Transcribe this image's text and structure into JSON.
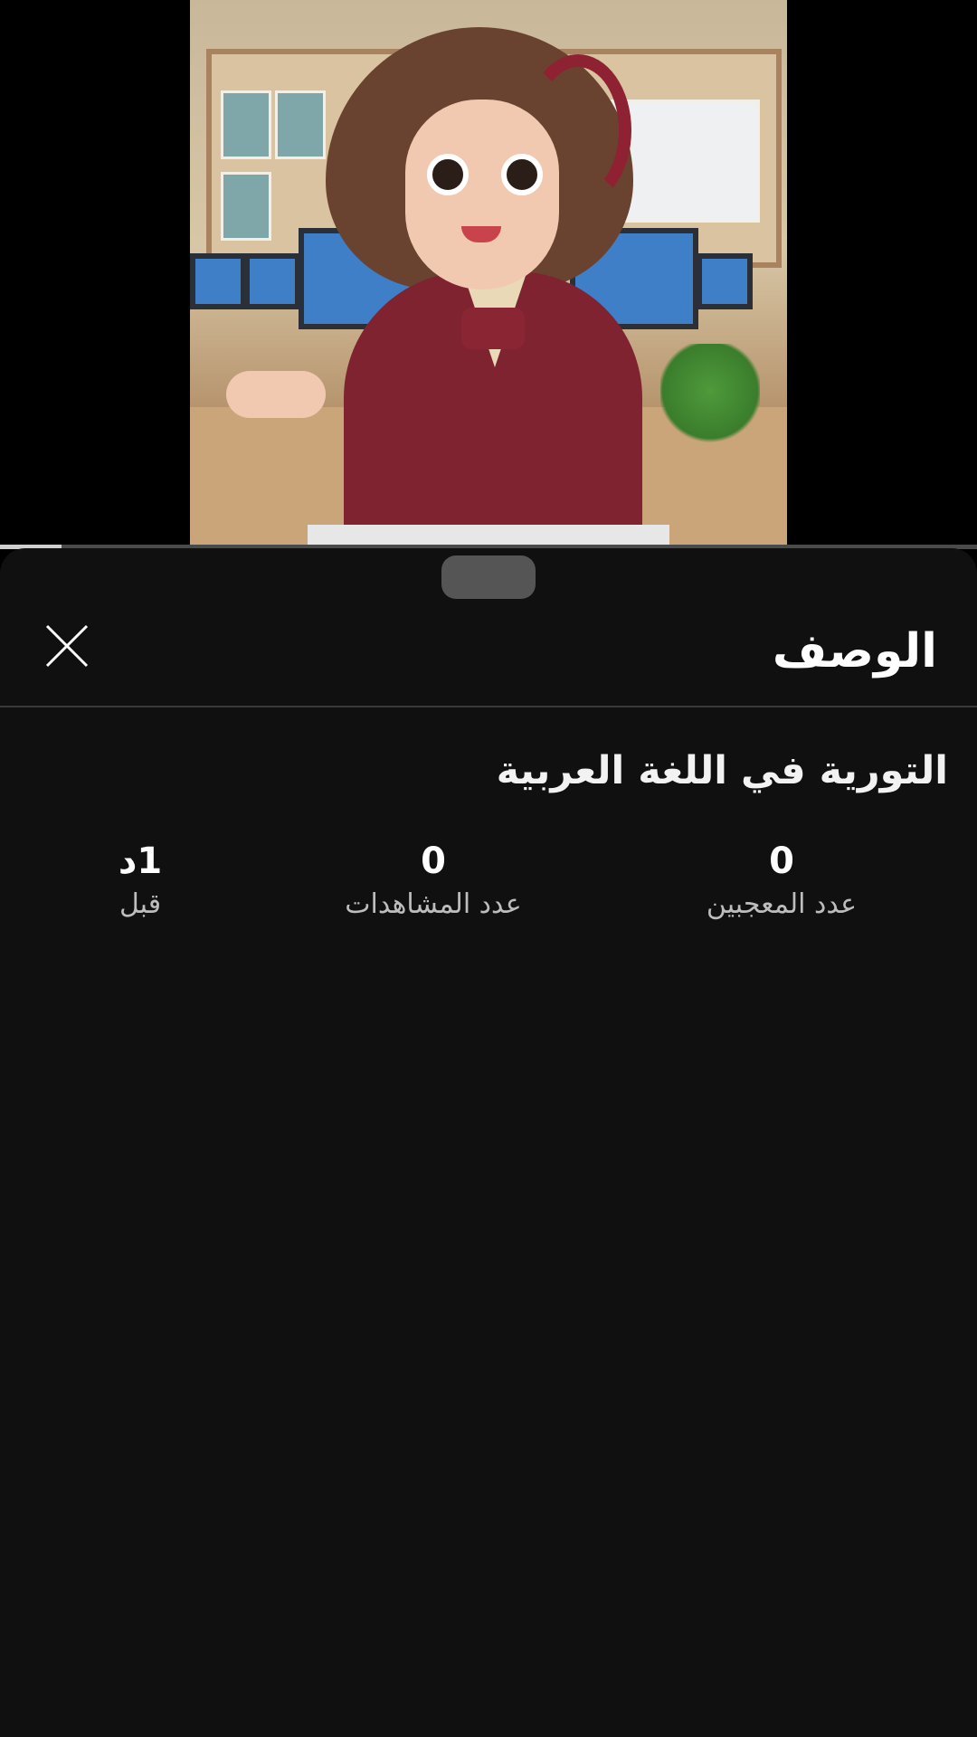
{
  "video": {
    "thumbnail_description_icon": "video-thumbnail",
    "progress_fraction": 0.063
  },
  "sheet": {
    "title": "الوصف",
    "close_icon": "close-icon",
    "video_title": "التورية في اللغة العربية",
    "stats": [
      {
        "value": "0",
        "label": "عدد المعجبين"
      },
      {
        "value": "0",
        "label": "عدد المشاهدات"
      },
      {
        "value": "1د",
        "label": "قبل"
      }
    ]
  },
  "colors": {
    "background": "#000000",
    "sheet_background": "#101010",
    "divider": "#3a3a3a",
    "text_primary": "#ffffff",
    "text_secondary": "#bdbdbd"
  }
}
